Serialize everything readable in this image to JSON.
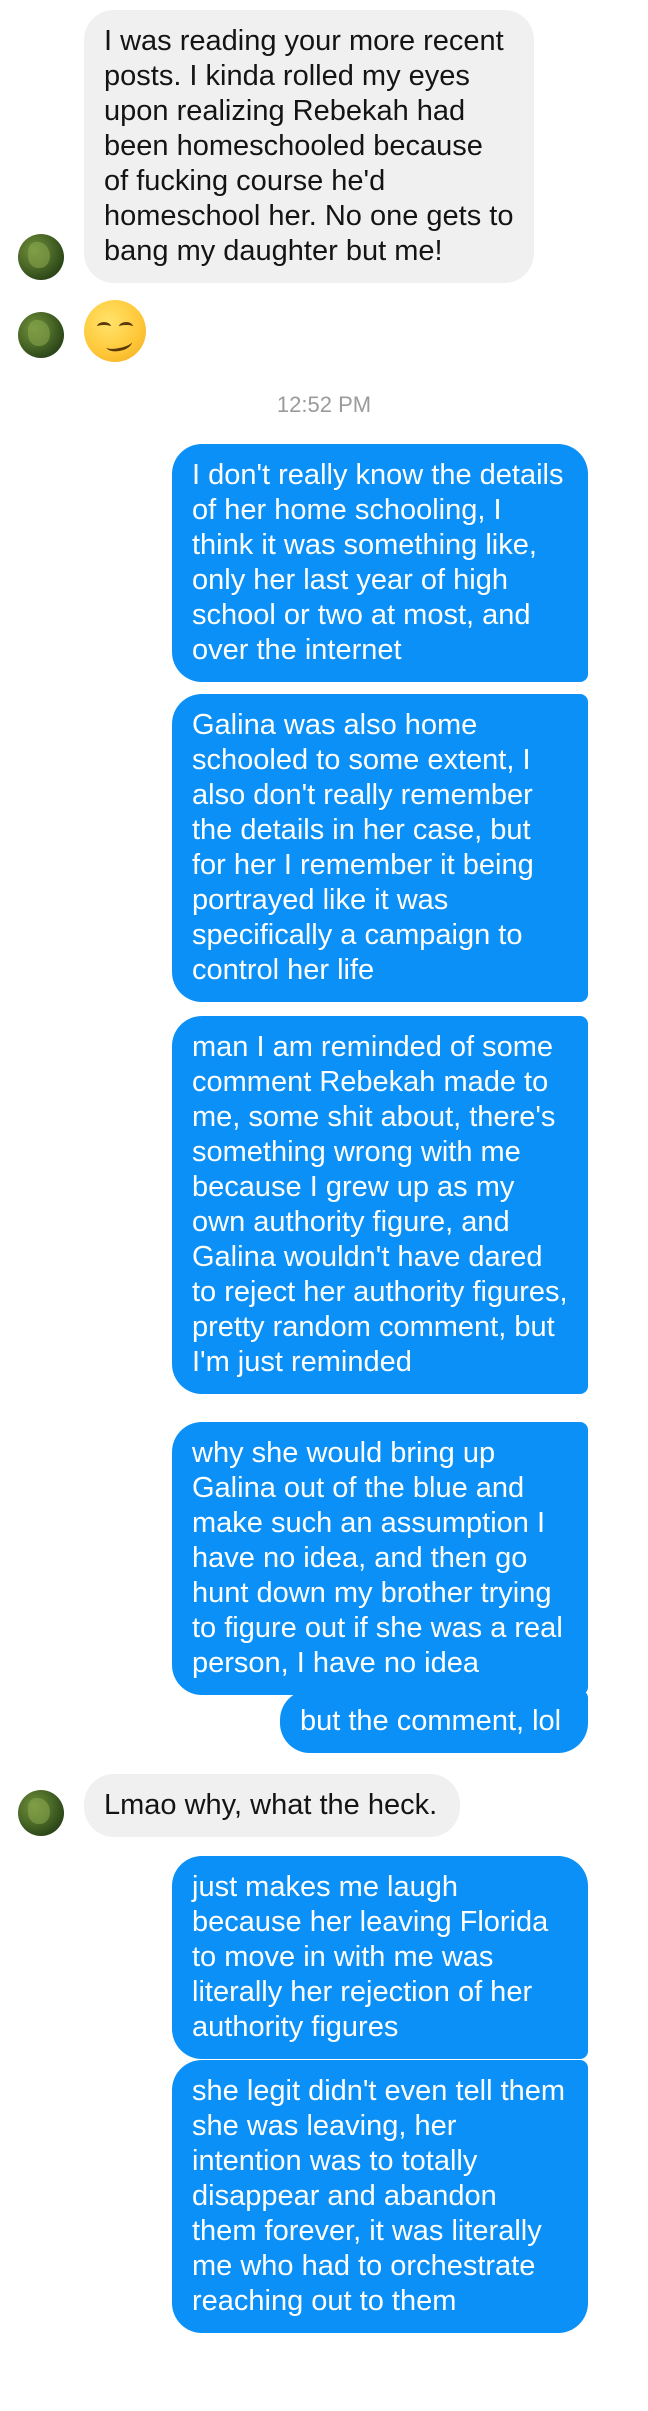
{
  "conversation": {
    "messages": [
      {
        "id": "m1",
        "direction": "incoming",
        "text": "I was reading your more recent posts. I kinda rolled my eyes upon realizing Rebekah had been homeschooled because of fucking course he'd homeschool her. No one gets to bang my daughter but me!"
      },
      {
        "id": "m2",
        "direction": "incoming",
        "type": "emoji",
        "emoji": "smirking-face"
      },
      {
        "id": "m3",
        "direction": "outgoing",
        "text": "I don't really know the details of her home schooling, I think it was something like, only her last year of high school or two at most, and over the internet"
      },
      {
        "id": "m4",
        "direction": "outgoing",
        "text": "Galina was also home schooled to some extent, I also don't really remember the details in her case, but for her I remember it being portrayed like it was specifically a campaign to control her life"
      },
      {
        "id": "m5",
        "direction": "outgoing",
        "text": "man I am reminded of some comment Rebekah made to me, some shit about, there's something wrong with me because I grew up as my own authority figure, and Galina wouldn't have dared to reject her authority figures, pretty random comment, but I'm just reminded"
      },
      {
        "id": "m6",
        "direction": "outgoing",
        "text": "why she would bring up Galina out of the blue and make such an assumption I have no idea, and then go hunt down my brother trying to figure out if she was a real person, I have no idea"
      },
      {
        "id": "m7",
        "direction": "outgoing",
        "text": "but the comment, lol"
      },
      {
        "id": "m8",
        "direction": "incoming",
        "text": "Lmao why, what the heck."
      },
      {
        "id": "m9",
        "direction": "outgoing",
        "text": "just makes me laugh because her leaving Florida to move in with me was literally her rejection of her authority figures"
      },
      {
        "id": "m10",
        "direction": "outgoing",
        "text": "she legit didn't even tell them she was leaving, her intention was to totally disappear and abandon them forever, it was literally me who had to orchestrate reaching out to them"
      }
    ],
    "timestamp": "12:52 PM"
  },
  "colors": {
    "incoming_bubble": "#f0f0f0",
    "outgoing_bubble": "#0a90f6",
    "timestamp_text": "#9b9b9b"
  }
}
